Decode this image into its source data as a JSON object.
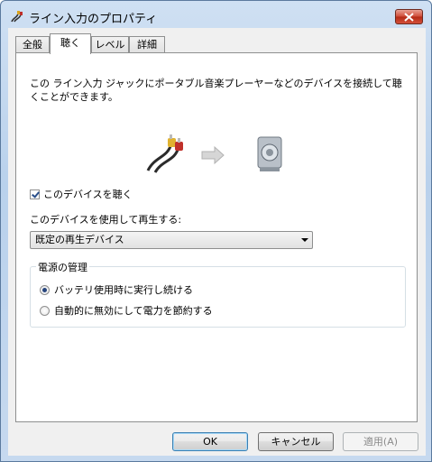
{
  "window": {
    "title": "ライン入力のプロパティ",
    "icon": "audio-cable-icon"
  },
  "tabs": [
    {
      "label": "全般"
    },
    {
      "label": "聴く"
    },
    {
      "label": "レベル"
    },
    {
      "label": "詳細"
    }
  ],
  "active_tab": "聴く",
  "listen": {
    "description": "この ライン入力 ジャックにポータブル音楽プレーヤーなどのデバイスを接続して聴くことができます。",
    "listen_checkbox_label": "このデバイスを聴く",
    "listen_checked": true,
    "playback_label": "このデバイスを使用して再生する:",
    "playback_device": "既定の再生デバイス",
    "power_group_title": "電源の管理",
    "power_options": [
      {
        "label": "バッテリ使用時に実行し続ける",
        "selected": true
      },
      {
        "label": "自動的に無効にして電力を節約する",
        "selected": false
      }
    ]
  },
  "buttons": {
    "ok": "OK",
    "cancel": "キャンセル",
    "apply": "適用(A)"
  },
  "colors": {
    "close_button": "#cf4a36",
    "selection": "#27457d"
  }
}
